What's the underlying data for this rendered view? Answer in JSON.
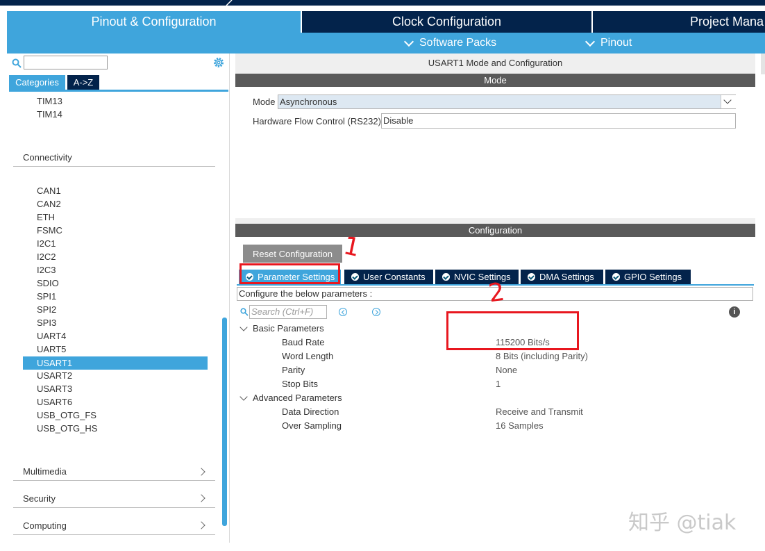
{
  "main_tabs": {
    "pinout": "Pinout & Configuration",
    "clock": "Clock Configuration",
    "project": "Project Mana"
  },
  "subbar": {
    "software_packs": "Software Packs",
    "pinout": "Pinout"
  },
  "sidebar": {
    "search_placeholder": "",
    "tab_categories": "Categories",
    "tab_az": "A->Z",
    "timers_items": [
      "TIM13",
      "TIM14"
    ],
    "connectivity_label": "Connectivity",
    "connectivity_items": [
      "CAN1",
      "CAN2",
      "ETH",
      "FSMC",
      "I2C1",
      "I2C2",
      "I2C3",
      "SDIO",
      "SPI1",
      "SPI2",
      "SPI3",
      "UART4",
      "UART5",
      "USART1",
      "USART2",
      "USART3",
      "USART6",
      "USB_OTG_FS",
      "USB_OTG_HS"
    ],
    "selected_item": "USART1",
    "collapsed_sections": [
      "Multimedia",
      "Security",
      "Computing"
    ]
  },
  "mode_panel": {
    "title": "USART1 Mode and Configuration",
    "header": "Mode",
    "mode_label": "Mode",
    "mode_value": "Asynchronous",
    "hfc_label": "Hardware Flow Control (RS232)",
    "hfc_value": "Disable"
  },
  "config_panel": {
    "header": "Configuration",
    "reset_button": "Reset Configuration",
    "tabs": [
      "Parameter Settings",
      "User Constants",
      "NVIC Settings",
      "DMA Settings",
      "GPIO Settings"
    ],
    "active_tab": "Parameter Settings",
    "configure_text": "Configure the below parameters :",
    "search_placeholder": "Search (Ctrl+F)",
    "groups": [
      {
        "label": "Basic Parameters",
        "params": [
          {
            "name": "Baud Rate",
            "value": "115200 Bits/s"
          },
          {
            "name": "Word Length",
            "value": "8 Bits (including Parity)"
          },
          {
            "name": "Parity",
            "value": "None"
          },
          {
            "name": "Stop Bits",
            "value": "1"
          }
        ]
      },
      {
        "label": "Advanced Parameters",
        "params": [
          {
            "name": "Data Direction",
            "value": "Receive and Transmit"
          },
          {
            "name": "Over Sampling",
            "value": "16 Samples"
          }
        ]
      }
    ]
  },
  "annotations": {
    "mark_1": "1",
    "mark_2": "2"
  },
  "watermark": "知乎 @tiak",
  "colors": {
    "accent": "#3fa5dc",
    "dark_navy": "#03234b",
    "panel_header": "#5a5a5a",
    "annotation_red": "#e8171f"
  }
}
